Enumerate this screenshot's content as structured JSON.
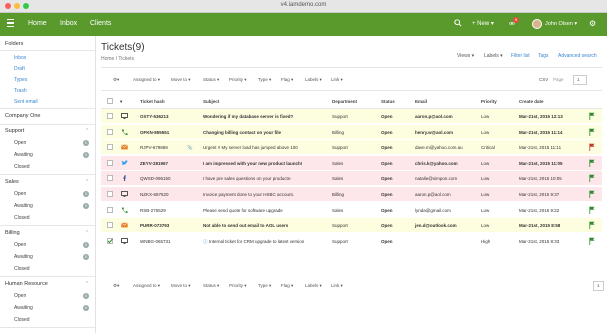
{
  "browser": {
    "url": "v4.iamdemo.com"
  },
  "nav": {
    "brand_links": [
      "Home",
      "Inbox",
      "Clients"
    ],
    "new_label": "+ New ▾",
    "notif_count": "9",
    "user": "John Olsen ▾"
  },
  "sidebar": {
    "folders_title": "Folders",
    "folders": [
      "Inbox",
      "Draft",
      "Types",
      "Trash",
      "Sent email"
    ],
    "company_title": "Company One",
    "groups": [
      {
        "name": "Support",
        "items": [
          "Open",
          "Awaiting",
          "Closed"
        ]
      },
      {
        "name": "Sales",
        "items": [
          "Open",
          "Awaiting",
          "Closed"
        ]
      },
      {
        "name": "Billing",
        "items": [
          "Open",
          "Awaiting",
          "Closed"
        ]
      },
      {
        "name": "Human Resource",
        "items": [
          "Open",
          "Awaiting",
          "Closed"
        ]
      }
    ]
  },
  "header": {
    "title": "Tickets(9)",
    "breadcrumb": "Home  /  Tickets",
    "views": "Views ▾",
    "labels": "Labels ▾",
    "filter": "Filter list",
    "tags": "Tags",
    "adv": "Advanced search"
  },
  "toolbar": {
    "items": [
      "Assigned to ▾",
      "Move to ▾",
      "Status ▾",
      "Priority ▾",
      "Type ▾",
      "Flag ▾",
      "Labels ▾",
      "Link ▾"
    ],
    "csv": "CSV",
    "page_label": "Page",
    "page_value": "1"
  },
  "table": {
    "columns": [
      "Ticket hash",
      "Subject",
      "Department",
      "Status",
      "Email",
      "Priority",
      "Create date"
    ],
    "rows": [
      {
        "hash": "OXTY-536213",
        "subject": "Wondering if my database server is fixed?",
        "dept": "Support",
        "status": "Open",
        "email": "aaron.p@aol.com",
        "priority": "Low",
        "date": "Mar-21st, 2015 12:13",
        "bold": true,
        "bg": "#fdfde0",
        "icon": "monitor",
        "flag": "#2e8b2e",
        "checked": false
      },
      {
        "hash": "OFKN-855551",
        "subject": "Changing billing contact on your file",
        "dept": "Billing",
        "status": "Open",
        "email": "henry.w@aol.com",
        "priority": "Low",
        "date": "Mar-21st, 2015 11:14",
        "bold": true,
        "bg": "#fdfde0",
        "icon": "phone",
        "flag": "#2e8b2e",
        "checked": false
      },
      {
        "hash": "RJPV-679869",
        "subject": "Urgent !! My server load has jumped above 100",
        "dept": "Support",
        "status": "Open",
        "email": "dave.m@yahoo.com.au",
        "priority": "Critical",
        "date": "Mar-21st, 2015 11:11",
        "bold": false,
        "bg": "#fdfde0",
        "icon": "mail",
        "flag": "#c0392b",
        "checked": false
      },
      {
        "hash": "ZEYV-281967",
        "subject": "I am impressed with your new product launch!",
        "dept": "Sales",
        "status": "Open",
        "email": "chris.k@yahoo.com",
        "priority": "Low",
        "date": "Mar-21st, 2015 11:05",
        "bold": true,
        "bg": "#fde7ea",
        "icon": "twitter",
        "flag": "#2e8b2e",
        "checked": false
      },
      {
        "hash": "QWSD-096150",
        "subject": "I have pre sales questions on your products-",
        "dept": "Sales",
        "status": "Open",
        "email": "natalie@simpon.com",
        "priority": "Low",
        "date": "Mar-21st, 2015 10:05",
        "bold": false,
        "bg": "#fde7ea",
        "icon": "facebook",
        "flag": "#2e8b2e",
        "checked": false
      },
      {
        "hash": "NZKX-687620",
        "subject": "Invoice payment done to your HSBC account.",
        "dept": "Billing",
        "status": "Open",
        "email": "aaron.p@aol.com",
        "priority": "Low",
        "date": "Mar-21st, 2015 9:37",
        "bold": false,
        "bg": "#fde7ea",
        "icon": "monitor",
        "flag": "#2e8b2e",
        "checked": false
      },
      {
        "hash": "RSB-275529",
        "subject": "Please send quote for software upgrade",
        "dept": "Sales",
        "status": "Open",
        "email": "lynda@gmail.com",
        "priority": "Low",
        "date": "Mar-21st, 2015 9:22",
        "bold": false,
        "bg": "#ffffff",
        "icon": "phone",
        "flag": "#2e8b2e",
        "checked": false
      },
      {
        "hash": "PURR-073793",
        "subject": "Not able to send out email to AOL users",
        "dept": "Support",
        "status": "Open",
        "email": "jen.d@outlook.com",
        "priority": "Low",
        "date": "Mar-21st, 2015 8:58",
        "bold": true,
        "bg": "#fdfde0",
        "icon": "mail",
        "flag": "#2e8b2e",
        "checked": false
      },
      {
        "hash": "WNBG-065731",
        "subject": "Internal ticket for CRM upgrade to latest version",
        "dept": "Support",
        "status": "Open",
        "email": "",
        "priority": "High",
        "date": "Mar-21st, 2015 8:33",
        "bold": false,
        "bg": "#ffffff",
        "icon": "monitor",
        "flag": "#2e8b2e",
        "checked": true
      }
    ]
  },
  "colors": {
    "brand": "#5a9a2d",
    "link": "#3a86d4"
  }
}
